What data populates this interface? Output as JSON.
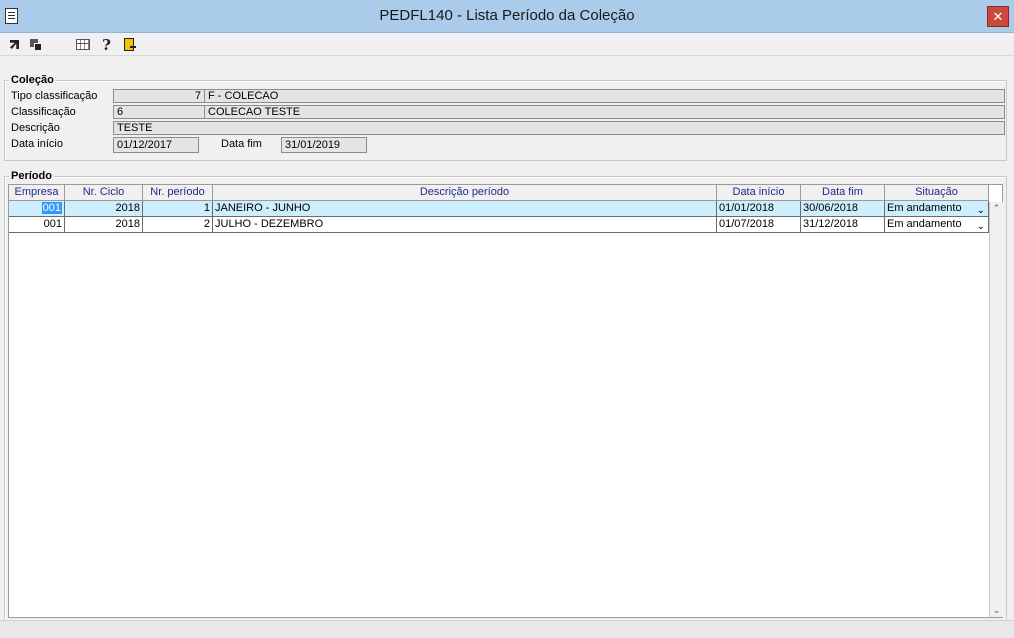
{
  "window": {
    "title": "PEDFL140 - Lista Período da Coleção",
    "close_label": "✕"
  },
  "toolbar": {
    "help_glyph": "?"
  },
  "colecao": {
    "legend": "Coleção",
    "tipo_label": "Tipo classificação",
    "tipo_code": "7",
    "tipo_desc": "F - COLECAO",
    "classif_label": "Classificação",
    "classif_code": "6",
    "classif_desc": "COLECAO TESTE",
    "descricao_label": "Descrição",
    "descricao_value": "TESTE",
    "data_inicio_label": "Data início",
    "data_inicio_value": "01/12/2017",
    "data_fim_label": "Data fim",
    "data_fim_value": "31/01/2019"
  },
  "periodo": {
    "legend": "Período",
    "columns": [
      "Empresa",
      "Nr. Ciclo",
      "Nr. período",
      "Descrição período",
      "Data início",
      "Data fim",
      "Situação"
    ],
    "rows": [
      {
        "empresa": "001",
        "ciclo": "2018",
        "periodo": "1",
        "descricao": "JANEIRO - JUNHO",
        "inicio": "01/01/2018",
        "fim": "30/06/2018",
        "situacao": "Em andamento"
      },
      {
        "empresa": "001",
        "ciclo": "2018",
        "periodo": "2",
        "descricao": "JULHO - DEZEMBRO",
        "inicio": "01/07/2018",
        "fim": "31/12/2018",
        "situacao": "Em andamento"
      }
    ]
  },
  "colors": {
    "titlebar": "#aacbea",
    "selected_row": "#cdeefc",
    "header_text": "#1f2a8a",
    "close": "#c94a3b"
  }
}
